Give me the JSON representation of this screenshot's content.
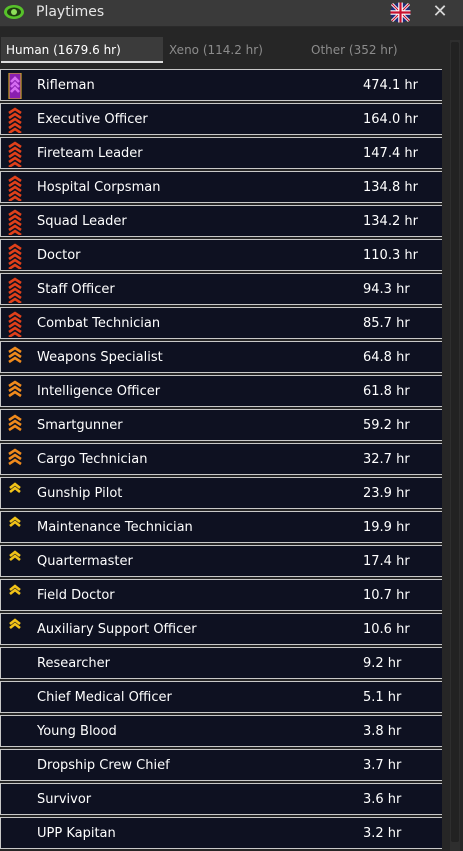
{
  "window": {
    "title": "Playtimes"
  },
  "tabs": [
    {
      "label": "Human (1679.6 hr)"
    },
    {
      "label": "Xeno (114.2 hr)"
    },
    {
      "label": "Other (352 hr)"
    }
  ],
  "colors": {
    "chevron_red": "#e0401a",
    "chevron_orange": "#f08a1c",
    "chevron_yellow": "#f2c318",
    "stripe_purple": "#8a1fb0"
  },
  "roles": [
    {
      "name": "Rifleman",
      "time": "474.1 hr",
      "icon": "purple-rank-stripe-icon"
    },
    {
      "name": "Executive Officer",
      "time": "164.0 hr",
      "icon": "red-chevron-stack-icon"
    },
    {
      "name": "Fireteam Leader",
      "time": "147.4 hr",
      "icon": "red-chevron-stack-icon"
    },
    {
      "name": "Hospital Corpsman",
      "time": "134.8 hr",
      "icon": "red-chevron-stack-icon"
    },
    {
      "name": "Squad Leader",
      "time": "134.2 hr",
      "icon": "red-chevron-stack-icon"
    },
    {
      "name": "Doctor",
      "time": "110.3 hr",
      "icon": "red-chevron-stack-icon"
    },
    {
      "name": "Staff Officer",
      "time": "94.3 hr",
      "icon": "red-chevron-stack-icon"
    },
    {
      "name": "Combat Technician",
      "time": "85.7 hr",
      "icon": "red-chevron-stack-icon"
    },
    {
      "name": "Weapons Specialist",
      "time": "64.8 hr",
      "icon": "orange-chevron-stack-icon"
    },
    {
      "name": "Intelligence Officer",
      "time": "61.8 hr",
      "icon": "orange-chevron-stack-icon"
    },
    {
      "name": "Smartgunner",
      "time": "59.2 hr",
      "icon": "orange-chevron-stack-icon"
    },
    {
      "name": "Cargo Technician",
      "time": "32.7 hr",
      "icon": "orange-chevron-stack-icon"
    },
    {
      "name": "Gunship Pilot",
      "time": "23.9 hr",
      "icon": "yellow-chevron-icon"
    },
    {
      "name": "Maintenance Technician",
      "time": "19.9 hr",
      "icon": "yellow-chevron-icon"
    },
    {
      "name": "Quartermaster",
      "time": "17.4 hr",
      "icon": "yellow-chevron-icon"
    },
    {
      "name": "Field Doctor",
      "time": "10.7 hr",
      "icon": "yellow-chevron-icon"
    },
    {
      "name": "Auxiliary Support Officer",
      "time": "10.6 hr",
      "icon": "yellow-chevron-icon"
    },
    {
      "name": "Researcher",
      "time": "9.2 hr",
      "icon": ""
    },
    {
      "name": "Chief Medical Officer",
      "time": "5.1 hr",
      "icon": ""
    },
    {
      "name": "Young Blood",
      "time": "3.8 hr",
      "icon": ""
    },
    {
      "name": "Dropship Crew Chief",
      "time": "3.7 hr",
      "icon": ""
    },
    {
      "name": "Survivor",
      "time": "3.6 hr",
      "icon": ""
    },
    {
      "name": "UPP Kapitan",
      "time": "3.2 hr",
      "icon": ""
    }
  ]
}
